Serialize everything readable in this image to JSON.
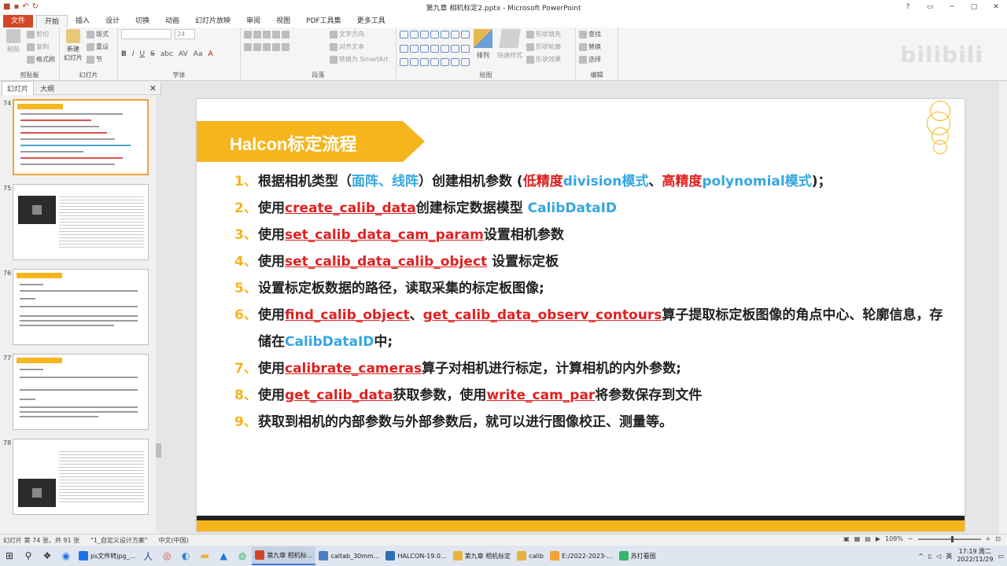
{
  "window": {
    "title": "第九章 相机标定2.pptx - Microsoft PowerPoint"
  },
  "ribbon_tabs": [
    "文件",
    "开始",
    "插入",
    "设计",
    "切换",
    "动画",
    "幻灯片放映",
    "审阅",
    "视图",
    "PDF工具集",
    "更多工具"
  ],
  "ribbon": {
    "clipboard": {
      "paste": "粘贴",
      "cut": "剪切",
      "copy": "复制",
      "format_painter": "格式刷",
      "label": "剪贴板"
    },
    "slides": {
      "new_slide": "新建\n幻灯片",
      "layout": "版式",
      "reset": "重设",
      "section": "节",
      "label": "幻灯片"
    },
    "font": {
      "size": "24",
      "bold": "B",
      "italic": "I",
      "underline": "U",
      "strike": "S",
      "shadow": "abc",
      "spacing": "AV",
      "case": "Aa",
      "color": "A",
      "label": "字体"
    },
    "paragraph": {
      "text_direction": "文字方向",
      "align_text": "对齐文本",
      "smartart": "转换为 SmartArt",
      "label": "段落"
    },
    "drawing": {
      "arrange": "排列",
      "quick_styles": "快速样式",
      "shape_fill": "形状填充",
      "shape_outline": "形状轮廓",
      "shape_effects": "形状效果",
      "label": "绘图"
    },
    "editing": {
      "find": "查找",
      "replace": "替换",
      "select": "选择",
      "label": "编辑"
    }
  },
  "watermark": "bilibili",
  "left_pane": {
    "tabs": [
      "幻灯片",
      "大纲"
    ],
    "slides": [
      {
        "num": "74"
      },
      {
        "num": "75"
      },
      {
        "num": "76"
      },
      {
        "num": "77"
      },
      {
        "num": "78"
      }
    ]
  },
  "slide": {
    "title": "Halcon标定流程",
    "items": [
      {
        "num": "1、",
        "parts": [
          {
            "t": "根据相机类型（",
            "c": ""
          },
          {
            "t": "面阵、线阵",
            "c": "blue"
          },
          {
            "t": "）创建相机参数 (",
            "c": ""
          },
          {
            "t": "低精度",
            "c": "red"
          },
          {
            "t": "division模式",
            "c": "blue"
          },
          {
            "t": "、",
            "c": ""
          },
          {
            "t": "高精度",
            "c": "red"
          },
          {
            "t": "polynomial模式",
            "c": "blue"
          },
          {
            "t": ")；",
            "c": ""
          }
        ]
      },
      {
        "num": "2、",
        "parts": [
          {
            "t": "使用",
            "c": ""
          },
          {
            "t": "create_calib_data",
            "c": "red ul"
          },
          {
            "t": "创建标定数据模型 ",
            "c": ""
          },
          {
            "t": "CalibDataID",
            "c": "blue"
          }
        ]
      },
      {
        "num": "3、",
        "parts": [
          {
            "t": "使用",
            "c": ""
          },
          {
            "t": "set_calib_data_cam_param",
            "c": "red ul"
          },
          {
            "t": "设置相机参数",
            "c": ""
          }
        ]
      },
      {
        "num": "4、",
        "parts": [
          {
            "t": "使用",
            "c": ""
          },
          {
            "t": "set_calib_data_calib_object",
            "c": "red ul"
          },
          {
            "t": " 设置标定板",
            "c": ""
          }
        ]
      },
      {
        "num": "5、",
        "parts": [
          {
            "t": "设置标定板数据的路径，读取采集的标定板图像;",
            "c": ""
          }
        ]
      },
      {
        "num": "6、",
        "parts": [
          {
            "t": "使用",
            "c": ""
          },
          {
            "t": "find_calib_object",
            "c": "red ul"
          },
          {
            "t": "、",
            "c": ""
          },
          {
            "t": "get_calib_data_observ_contours",
            "c": "red ul"
          },
          {
            "t": "算子提取标定板图像的角点中心、轮廓信息，存储在",
            "c": ""
          },
          {
            "t": "CalibDataID",
            "c": "blue"
          },
          {
            "t": "中;",
            "c": ""
          }
        ]
      },
      {
        "num": "7、",
        "parts": [
          {
            "t": "使用",
            "c": ""
          },
          {
            "t": "calibrate_cameras",
            "c": "red ul"
          },
          {
            "t": "算子对相机进行标定，计算相机的内外参数;",
            "c": ""
          }
        ]
      },
      {
        "num": "8、",
        "parts": [
          {
            "t": "使用",
            "c": ""
          },
          {
            "t": "get_calib_data",
            "c": "red ul"
          },
          {
            "t": "获取参数，使用",
            "c": ""
          },
          {
            "t": "write_cam_par",
            "c": "red ul"
          },
          {
            "t": "将参数保存到文件",
            "c": ""
          }
        ]
      },
      {
        "num": "9、",
        "parts": [
          {
            "t": "获取到相机的内部参数与外部参数后，就可以进行图像校正、测量等。",
            "c": ""
          }
        ]
      }
    ]
  },
  "status": {
    "slide_info": "幻灯片 第 74 张，共 91 张",
    "theme": "\"1_自定义设计方案\"",
    "language": "中文(中国)",
    "zoom": "108%"
  },
  "taskbar": {
    "apps": [
      {
        "label": "ps文件转jpg_...",
        "color": "#1a73e8"
      },
      {
        "label": "第九章 相机标...",
        "color": "#d24726",
        "active": true
      },
      {
        "label": "caltab_30mm...",
        "color": "#4a7fc1"
      },
      {
        "label": "HALCON-19.0...",
        "color": "#2c6fb5"
      },
      {
        "label": "第九章 相机标定",
        "color": "#e8b23d"
      },
      {
        "label": "calib",
        "color": "#e8b23d"
      },
      {
        "label": "E:/2022-2023-...",
        "color": "#f2a33a"
      },
      {
        "label": "苏打看图",
        "color": "#37b36b"
      }
    ],
    "ime": "英",
    "time": "17:19 周二",
    "date": "2022/11/29"
  }
}
